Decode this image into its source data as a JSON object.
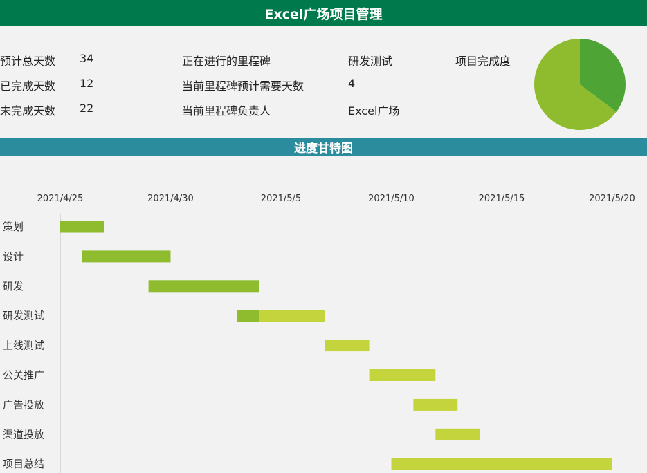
{
  "title": "Excel广场项目管理",
  "stats": {
    "total_days_label": "预计总天数",
    "total_days": "34",
    "done_days_label": "已完成天数",
    "done_days": "12",
    "remaining_days_label": "未完成天数",
    "remaining_days": "22",
    "current_milestone_label": "正在进行的里程碑",
    "current_milestone": "研发测试",
    "milestone_days_label": "当前里程碑预计需要天数",
    "milestone_days": "4",
    "owner_label": "当前里程碑负责人",
    "owner": "Excel广场",
    "completion_label": "项目完成度"
  },
  "completion": {
    "type": "pie",
    "slices": [
      {
        "value": 12,
        "color": "#4ea435"
      },
      {
        "value": 22,
        "color": "#8fbc2f"
      }
    ]
  },
  "section_title": "进度甘特图",
  "chart_data": {
    "type": "bar",
    "orientation": "horizontal-stacked",
    "title": "",
    "xlabel": "",
    "ylabel": "",
    "x_ticks": [
      "2021/4/25",
      "2021/4/30",
      "2021/5/5",
      "2021/5/10",
      "2021/5/15",
      "2021/5/20"
    ],
    "x_range": [
      "2021/4/25",
      "2021/5/21"
    ],
    "legend": "none",
    "grid": false,
    "tasks": [
      {
        "name": "策划",
        "start": "2021/4/25",
        "done_days": 2,
        "remaining_days": 0
      },
      {
        "name": "设计",
        "start": "2021/4/26",
        "done_days": 4,
        "remaining_days": 0
      },
      {
        "name": "研发",
        "start": "2021/4/29",
        "done_days": 5,
        "remaining_days": 0
      },
      {
        "name": "研发测试",
        "start": "2021/5/3",
        "done_days": 1,
        "remaining_days": 3
      },
      {
        "name": "上线测试",
        "start": "2021/5/7",
        "done_days": 0,
        "remaining_days": 2
      },
      {
        "name": "公关推广",
        "start": "2021/5/9",
        "done_days": 0,
        "remaining_days": 3
      },
      {
        "name": "广告投放",
        "start": "2021/5/11",
        "done_days": 0,
        "remaining_days": 2
      },
      {
        "name": "渠道投放",
        "start": "2021/5/12",
        "done_days": 0,
        "remaining_days": 2
      },
      {
        "name": "项目总结",
        "start": "2021/5/10",
        "done_days": 0,
        "remaining_days": 10
      }
    ],
    "colors": {
      "done": "#8fbc2f",
      "remaining": "#c4d43c"
    }
  }
}
